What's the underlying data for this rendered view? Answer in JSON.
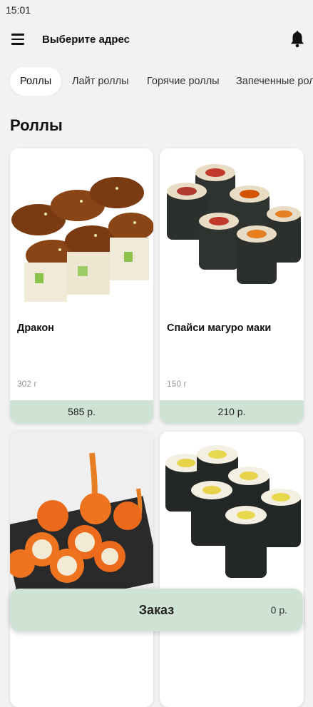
{
  "status_bar": {
    "time": "15:01"
  },
  "app_bar": {
    "address_label": "Выберите адрес"
  },
  "tabs": [
    {
      "label": "Роллы"
    },
    {
      "label": "Лайт роллы"
    },
    {
      "label": "Горячие роллы"
    },
    {
      "label": "Запеченные роллы"
    }
  ],
  "section": {
    "title": "Роллы"
  },
  "products": [
    {
      "name": "Дракон",
      "weight": "302 г",
      "price": "585 р."
    },
    {
      "name": "Спайси магуро маки",
      "weight": "150 г",
      "price": "210 р."
    },
    {
      "name": "",
      "weight": "",
      "price": ""
    },
    {
      "name": "",
      "weight": "",
      "price": ""
    }
  ],
  "order": {
    "label": "Заказ",
    "total": "0 р."
  },
  "colors": {
    "accent_green": "#cfe2d4",
    "background": "#f2f2f2"
  }
}
